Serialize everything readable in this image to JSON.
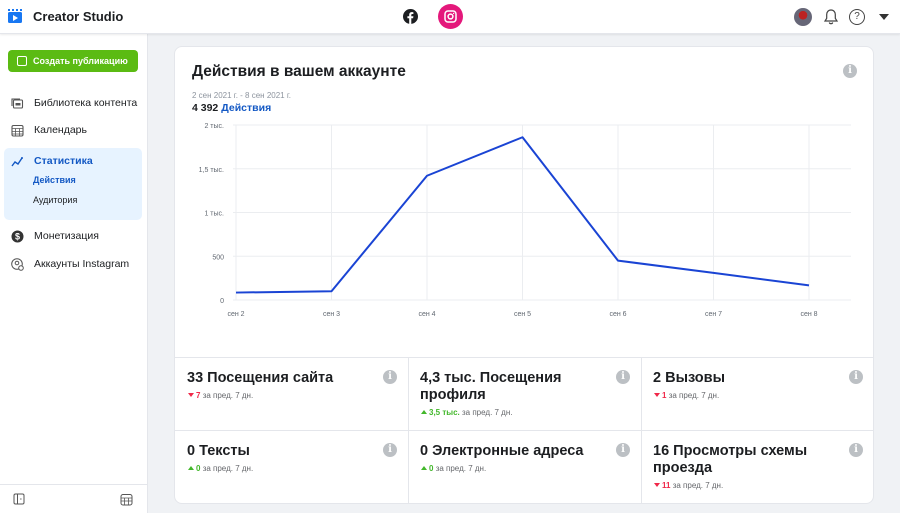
{
  "app": {
    "title": "Creator Studio",
    "platforms": [
      {
        "name": "Facebook",
        "icon": "facebook-icon",
        "active": false
      },
      {
        "name": "Instagram",
        "icon": "instagram-icon",
        "active": true,
        "color": "#e4187b"
      }
    ]
  },
  "header_right": {
    "help_glyph": "?"
  },
  "sidebar": {
    "create_button": "Создать публикацию",
    "items": [
      {
        "label": "Библиотека контента",
        "icon": "content-library-icon"
      },
      {
        "label": "Календарь",
        "icon": "calendar-icon"
      },
      {
        "label": "Статистика",
        "icon": "insights-icon",
        "active": true,
        "sub_items": [
          {
            "label": "Действия",
            "active": true
          },
          {
            "label": "Аудитория",
            "active": false
          }
        ]
      },
      {
        "label": "Монетизация",
        "icon": "monetization-icon"
      },
      {
        "label": "Аккаунты Instagram",
        "icon": "instagram-accounts-icon"
      }
    ]
  },
  "card": {
    "title": "Действия в вашем аккаунте",
    "date_range": "2 сен 2021 г. - 8 сен 2021 г.",
    "total_value": "4 392",
    "total_label": "Действия",
    "info_glyph": "i"
  },
  "chart_data": {
    "type": "line",
    "title": "Действия в вашем аккаунте",
    "categories": [
      "сен 2",
      "сен 3",
      "сен 4",
      "сен 5",
      "сен 6",
      "сен 7",
      "сен 8"
    ],
    "series": [
      {
        "name": "Действия",
        "values": [
          85,
          100,
          1420,
          1860,
          450,
          310,
          167
        ],
        "color": "#1a44d4"
      }
    ],
    "yticks": [
      0,
      500,
      1000,
      1500,
      2000
    ],
    "ytick_labels": [
      "0",
      "500",
      "1 тыс.",
      "1,5 тыс.",
      "2 тыс."
    ],
    "ylim": [
      0,
      2000
    ],
    "xlabel": "",
    "ylabel": "",
    "grid": true
  },
  "metrics": [
    {
      "title": "33 Посещения сайта",
      "delta": "7",
      "direction": "down",
      "suffix": "за пред. 7 дн."
    },
    {
      "title": "4,3 тыс. Посещения профиля",
      "delta": "3,5 тыс.",
      "direction": "up",
      "suffix": "за пред. 7 дн."
    },
    {
      "title": "2 Вызовы",
      "delta": "1",
      "direction": "down",
      "suffix": "за пред. 7 дн."
    },
    {
      "title": "0 Тексты",
      "delta": "0",
      "direction": "up",
      "suffix": "за пред. 7 дн."
    },
    {
      "title": "0 Электронные адреса",
      "delta": "0",
      "direction": "up",
      "suffix": "за пред. 7 дн."
    },
    {
      "title": "16 Просмотры схемы проезда",
      "delta": "11",
      "direction": "down",
      "suffix": "за пред. 7 дн."
    }
  ]
}
